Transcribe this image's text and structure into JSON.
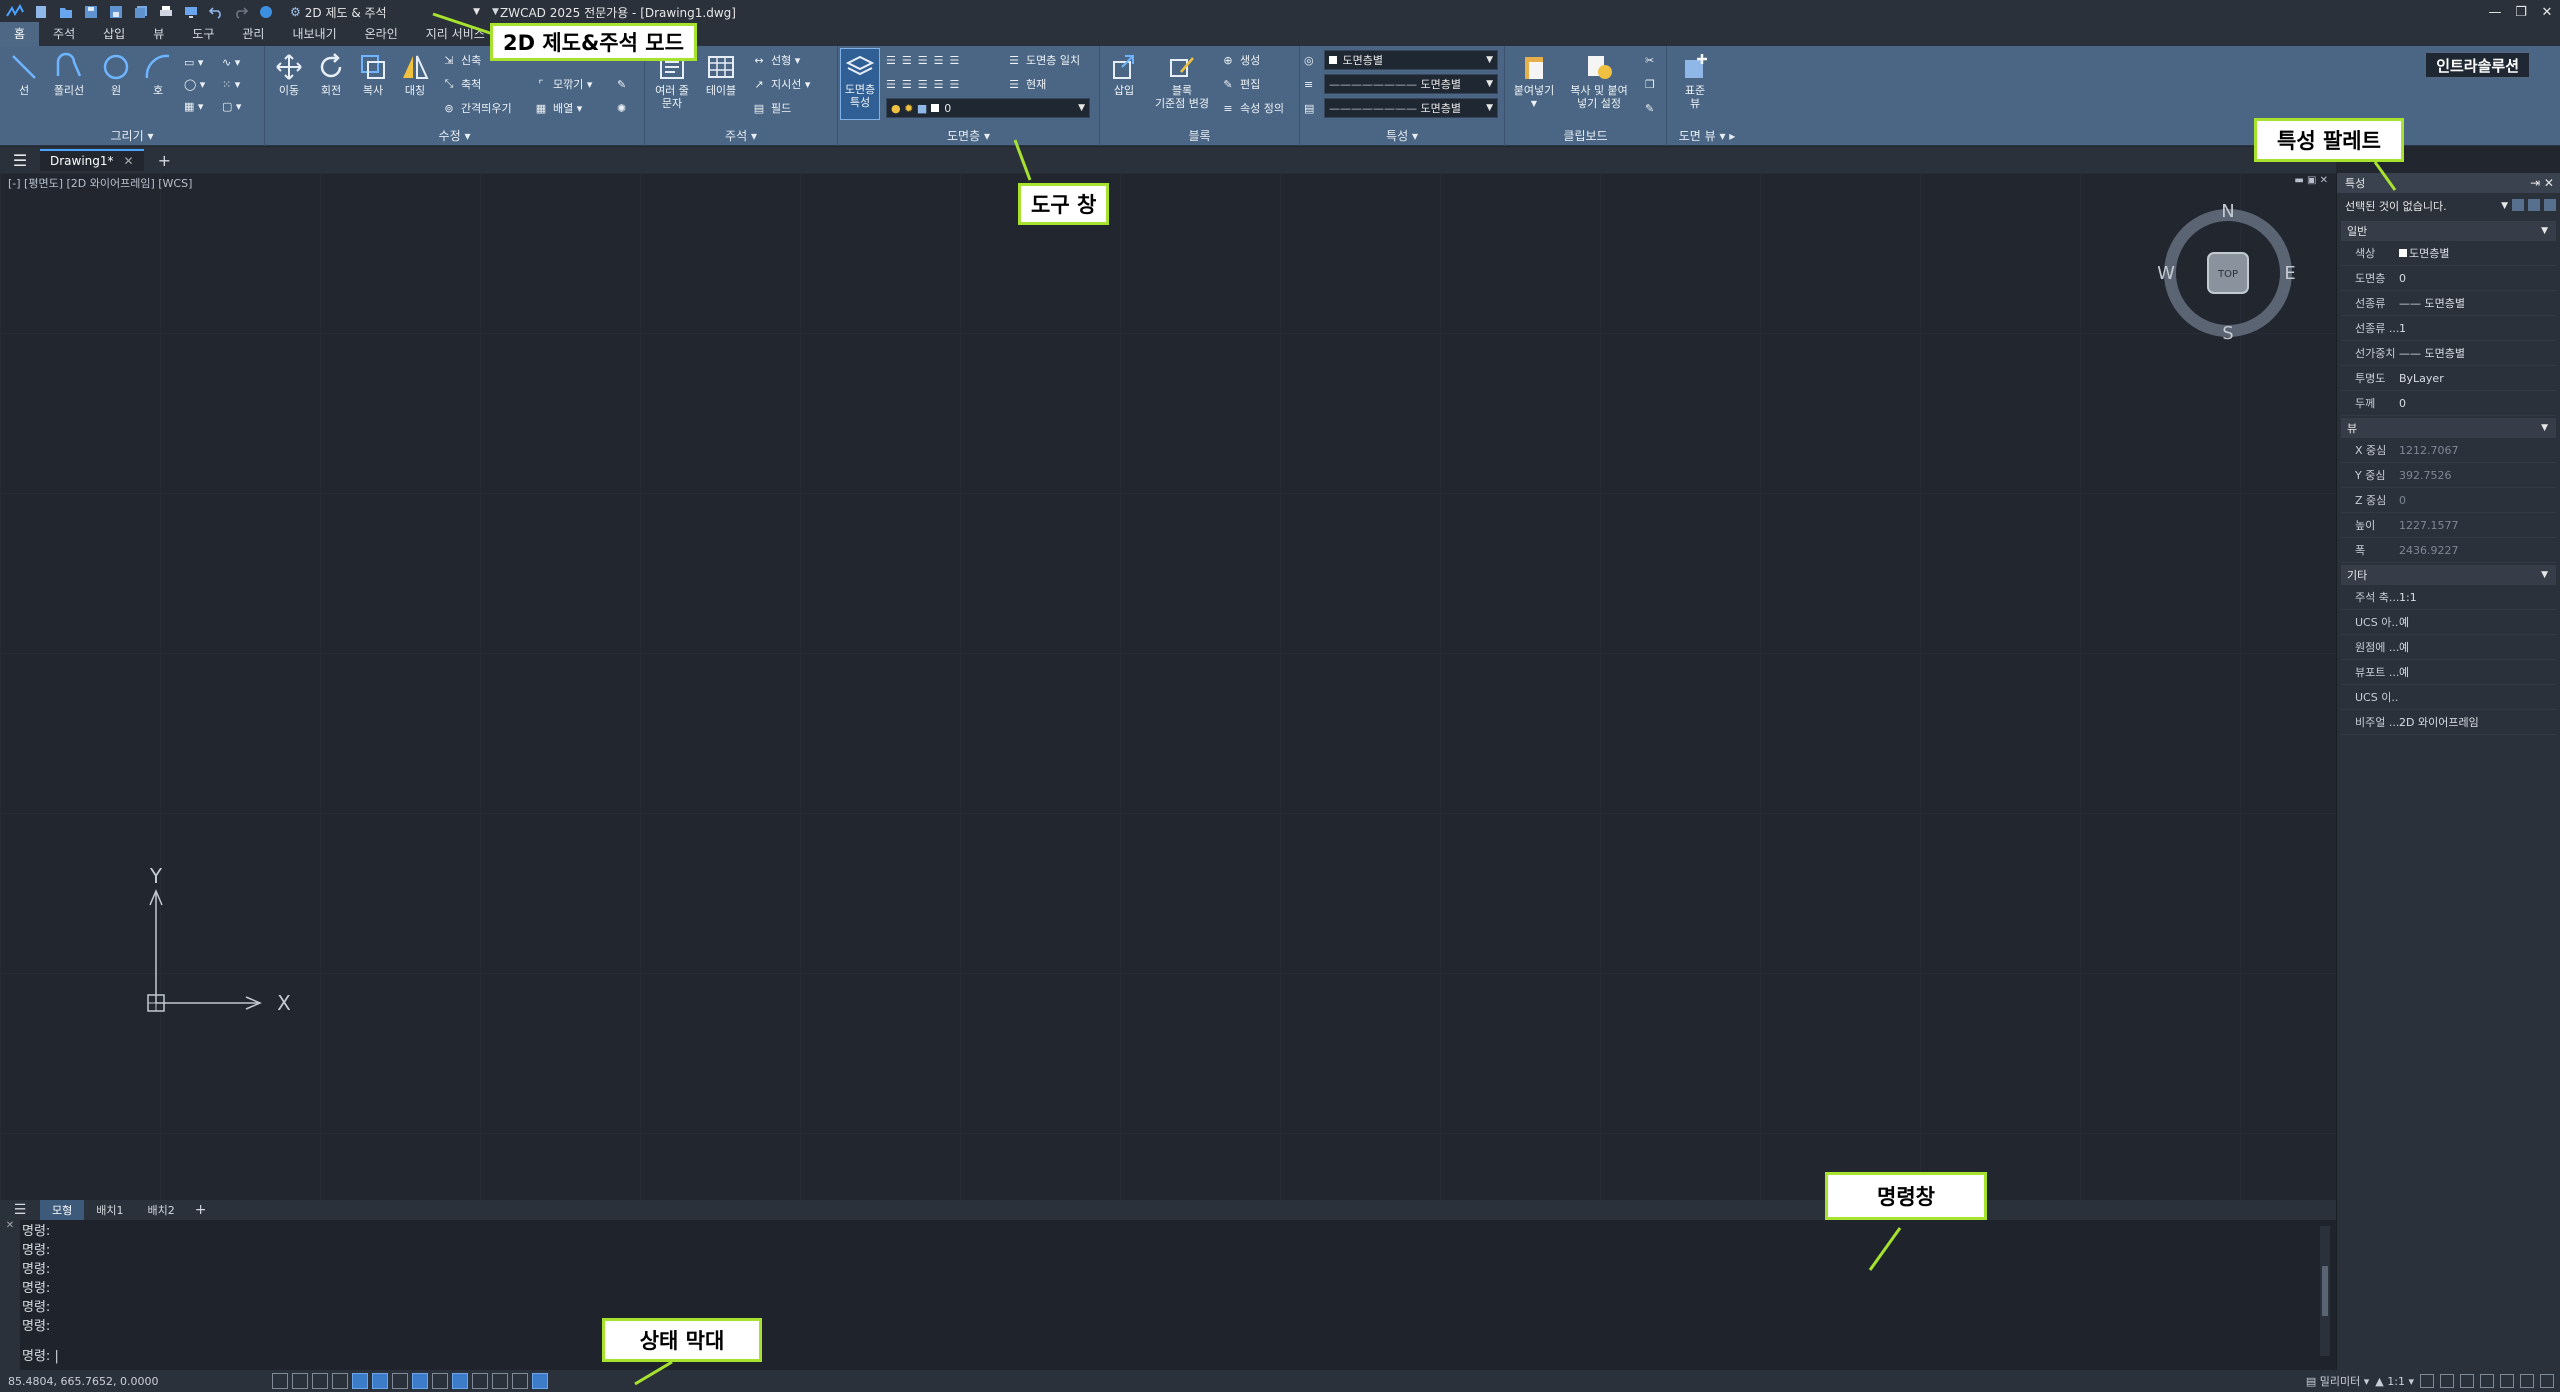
{
  "titlebar": {
    "workspace": "2D 제도 & 주석",
    "doc_title": "ZWCAD 2025 전문가용 - [Drawing1.dwg]"
  },
  "menu_tabs": [
    "홈",
    "주석",
    "삽입",
    "뷰",
    "도구",
    "관리",
    "내보내기",
    "온라인",
    "지리 서비스"
  ],
  "ribbon": {
    "draw": {
      "title": "그리기",
      "line": "선",
      "polyline": "폴리선",
      "circle": "원",
      "arc": "호"
    },
    "modify": {
      "title": "수정",
      "move": "이동",
      "rotate": "회전",
      "copy": "복사",
      "mirror": "대칭",
      "stretch": "신축",
      "scale": "축척",
      "offset": "간격띄우기",
      "fillet": "모깎기",
      "array": "배열"
    },
    "annotation": {
      "title": "주석",
      "mtext_line1": "여러 줄",
      "mtext_line2": "문자",
      "table": "테이블",
      "linear": "선형",
      "leader": "지시선",
      "field": "필드"
    },
    "layers": {
      "title": "도면층",
      "layer_props_line1": "도면층",
      "layer_props_line2": "특성",
      "match_layer": "도면층 일치",
      "current": "현재",
      "current_layer": "0"
    },
    "block": {
      "title": "블록",
      "insert": "삽입",
      "base_line1": "블록",
      "base_line2": "기준점 변경",
      "create": "생성",
      "edit": "편집",
      "define_attr": "속성 정의"
    },
    "properties": {
      "title": "특성",
      "color": "도면층별",
      "linetype": "도면층별",
      "lineweight": "도면층별"
    },
    "clipboard": {
      "title": "클립보드",
      "paste": "붙여넣기",
      "copy_paste_line1": "복사 및 붙여",
      "copy_paste_line2": "넣기 설정"
    },
    "view": {
      "title": "도면 뷰",
      "standard_line1": "표준",
      "standard_line2": "뷰"
    },
    "badge": "인트라솔루션"
  },
  "doc_tab": "Drawing1*",
  "viewport_label": "[-] [평면도] [2D 와이어프레임] [WCS]",
  "viewcube": {
    "top": "TOP",
    "n": "N",
    "s": "S",
    "e": "E",
    "w": "W"
  },
  "ucs": {
    "x": "X",
    "y": "Y"
  },
  "properties": {
    "title": "특성",
    "selection": "선택된 것이 없습니다.",
    "sections": [
      {
        "name": "일반",
        "rows": [
          {
            "key": "색상",
            "value": "도면층별"
          },
          {
            "key": "도면층",
            "value": "0"
          },
          {
            "key": "선종류",
            "value": "—— 도면층별"
          },
          {
            "key": "선종류 ...",
            "value": "1"
          },
          {
            "key": "선가중치",
            "value": "—— 도면층별"
          },
          {
            "key": "투명도",
            "value": "ByLayer"
          },
          {
            "key": "두께",
            "value": "0"
          }
        ]
      },
      {
        "name": "뷰",
        "rows": [
          {
            "key": "X 중심",
            "value": "1212.7067"
          },
          {
            "key": "Y 중심",
            "value": "392.7526"
          },
          {
            "key": "Z 중심",
            "value": "0"
          },
          {
            "key": "높이",
            "value": "1227.1577"
          },
          {
            "key": "폭",
            "value": "2436.9227"
          }
        ]
      },
      {
        "name": "기타",
        "rows": [
          {
            "key": "주석 축...",
            "value": "1:1"
          },
          {
            "key": "UCS 아...",
            "value": "예"
          },
          {
            "key": "원점에 ...",
            "value": "예"
          },
          {
            "key": "뷰포트 ...",
            "value": "예"
          },
          {
            "key": "UCS 이...",
            "value": ""
          },
          {
            "key": "비주얼 ...",
            "value": "2D 와이어프레임"
          }
        ]
      }
    ]
  },
  "layout_tabs": [
    "모형",
    "배치1",
    "배치2"
  ],
  "command": {
    "history": [
      "명령:",
      "명령:",
      "명령:",
      "명령:",
      "명령:",
      "명령:"
    ],
    "prompt": "명령:"
  },
  "status": {
    "coords": "85.4804, 665.7652, 0.0000",
    "units": "밀리미터",
    "scale": "1:1"
  },
  "callouts": {
    "workspace_mode": "2D 제도&주석 모드",
    "tool_window": "도구 창",
    "properties_palette": "특성 팔레트",
    "command_window": "명령창",
    "status_bar": "상태 막대"
  },
  "colors": {
    "accent": "#a6e22e",
    "ribbon": "#4a6684",
    "canvas": "#21262f"
  }
}
